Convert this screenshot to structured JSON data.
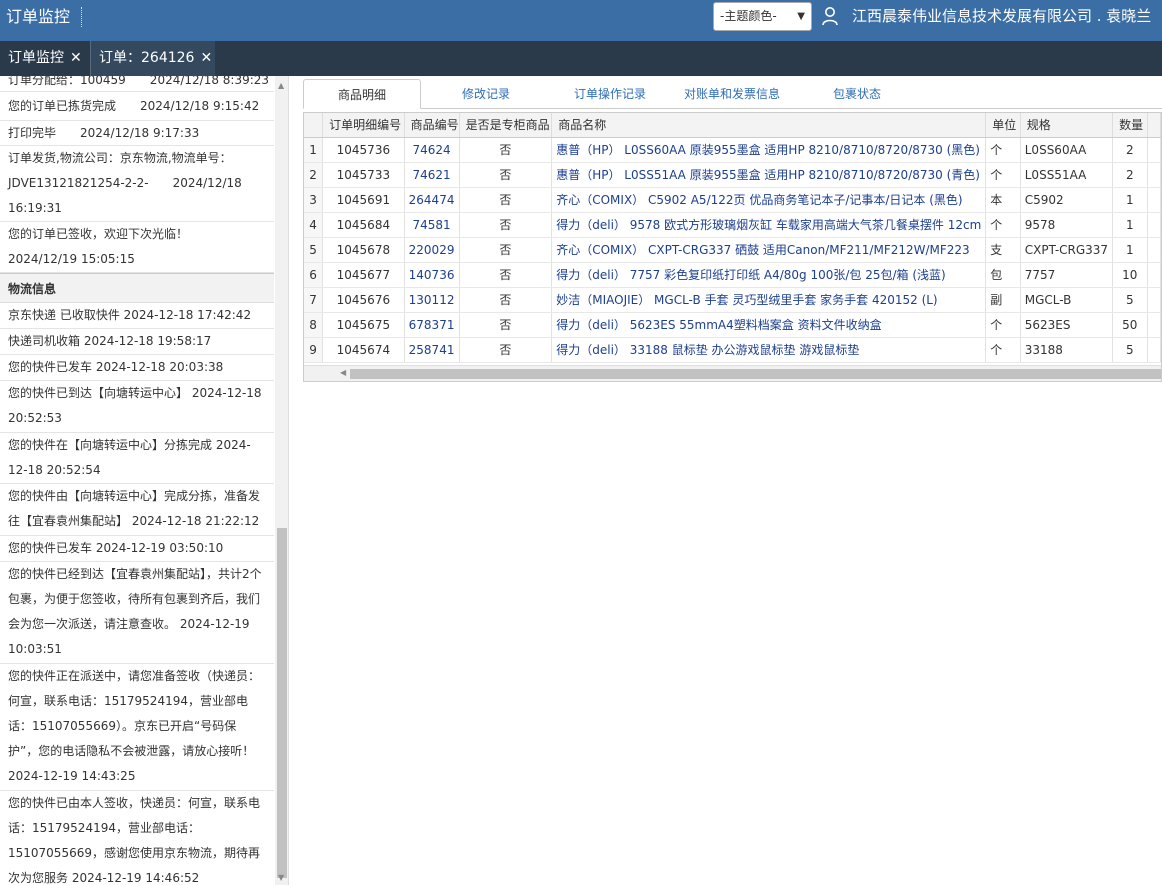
{
  "header": {
    "app_title": "订单监控",
    "theme_select": "-主题颜色-",
    "company": "江西晨泰伟业信息技术发展有限公司 . 袁晓兰"
  },
  "tabs": [
    {
      "label": "订单监控"
    },
    {
      "label": "订单：264126"
    }
  ],
  "order_log": [
    "订单分配给：100459　　2024/12/18 8:39:23",
    "您的订单已拣货完成　　2024/12/18 9:15:42",
    "打印完毕　　2024/12/18 9:17:33",
    "订单发货,物流公司：京东物流,物流单号：JDVE13121821254-2-2-　　2024/12/18 16:19:31",
    "您的订单已签收，欢迎下次光临！　　2024/12/19 15:05:15"
  ],
  "logistics": {
    "title": "物流信息",
    "items": [
      "京东快递 已收取快件 2024-12-18 17:42:42",
      "快递司机收箱 2024-12-18 19:58:17",
      "您的快件已发车 2024-12-18 20:03:38",
      "您的快件已到达【向塘转运中心】 2024-12-18 20:52:53",
      "您的快件在【向塘转运中心】分拣完成 2024-12-18 20:52:54",
      "您的快件由【向塘转运中心】完成分拣，准备发往【宜春袁州集配站】 2024-12-18 21:22:12",
      "您的快件已发车 2024-12-19 03:50:10",
      "您的快件已经到达【宜春袁州集配站】，共计2个包裹，为便于您签收，待所有包裹到齐后，我们会为您一次派送，请注意查收。 2024-12-19 10:03:51",
      "您的快件正在派送中，请您准备签收（快递员：何宣，联系电话：15179524194，营业部电话：15107055669）。京东已开启“号码保护”，您的电话隐私不会被泄露，请放心接听！ 2024-12-19 14:43:25",
      "您的快件已由本人签收，快递员：何宣，联系电话：15179524194，营业部电话：15107055669，感谢您使用京东物流，期待再次为您服务 2024-12-19 14:46:52"
    ]
  },
  "subtabs": [
    {
      "label": "商品明细"
    },
    {
      "label": "修改记录"
    },
    {
      "label": "订单操作记录"
    },
    {
      "label": "对账单和发票信息"
    },
    {
      "label": "包裹状态"
    }
  ],
  "table": {
    "columns": [
      "",
      "订单明细编号",
      "商品编号",
      "是否是专柜商品",
      "商品名称",
      "单位",
      "规格",
      "数量"
    ],
    "rows": [
      [
        "1",
        "1045736",
        "74624",
        "否",
        "惠普（HP） L0SS60AA 原装955墨盒 适用HP 8210/8710/8720/8730 (黑色)",
        "个",
        "L0SS60AA",
        "2"
      ],
      [
        "2",
        "1045733",
        "74621",
        "否",
        "惠普（HP） L0SS51AA 原装955墨盒 适用HP 8210/8710/8720/8730 (青色)",
        "个",
        "L0SS51AA",
        "2"
      ],
      [
        "3",
        "1045691",
        "264474",
        "否",
        "齐心（COMIX） C5902 A5/122页 优品商务笔记本子/记事本/日记本 (黑色)",
        "本",
        "C5902",
        "1"
      ],
      [
        "4",
        "1045684",
        "74581",
        "否",
        "得力（deli） 9578 欧式方形玻璃烟灰缸 车载家用高端大气茶几餐桌摆件 12cm",
        "个",
        "9578",
        "1"
      ],
      [
        "5",
        "1045678",
        "220029",
        "否",
        "齐心（COMIX） CXPT-CRG337 硒鼓 适用Canon/MF211/MF212W/MF223",
        "支",
        "CXPT-CRG337",
        "1"
      ],
      [
        "6",
        "1045677",
        "140736",
        "否",
        "得力（deli） 7757 彩色复印纸打印纸 A4/80g 100张/包 25包/箱 (浅蓝)",
        "包",
        "7757",
        "10"
      ],
      [
        "7",
        "1045676",
        "130112",
        "否",
        "妙洁（MIAOJIE） MGCL-B 手套 灵巧型绒里手套 家务手套 420152 (L)",
        "副",
        "MGCL-B",
        "5"
      ],
      [
        "8",
        "1045675",
        "678371",
        "否",
        "得力（deli） 5623ES 55mmA4塑料档案盒 资料文件收纳盒",
        "个",
        "5623ES",
        "50"
      ],
      [
        "9",
        "1045674",
        "258741",
        "否",
        "得力（deli） 33188 鼠标垫 办公游戏鼠标垫 游戏鼠标垫",
        "个",
        "33188",
        "5"
      ]
    ]
  },
  "icons": {
    "close": "close-icon",
    "user": "user-icon",
    "caret": "chevron-down-icon"
  }
}
